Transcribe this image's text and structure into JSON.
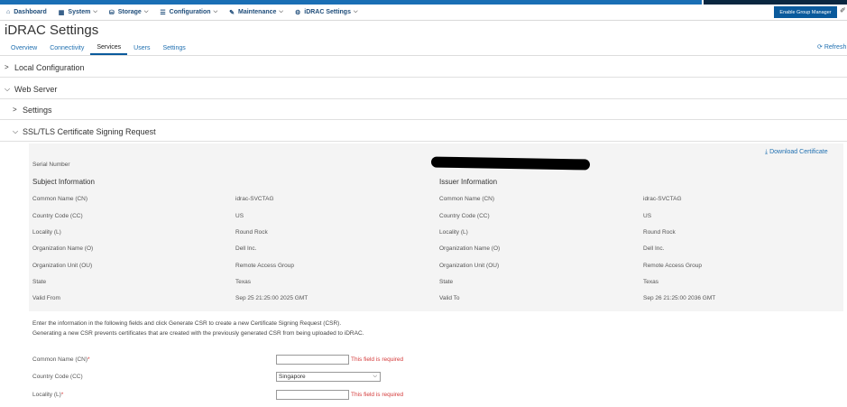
{
  "nav": {
    "items": [
      {
        "label": "Dashboard",
        "icon": "home-icon",
        "glyph": "⌂",
        "chevron": false
      },
      {
        "label": "System",
        "icon": "grid-icon",
        "glyph": "▦",
        "chevron": true
      },
      {
        "label": "Storage",
        "icon": "storage-icon",
        "glyph": "⛁",
        "chevron": true
      },
      {
        "label": "Configuration",
        "icon": "sliders-icon",
        "glyph": "☰",
        "chevron": true
      },
      {
        "label": "Maintenance",
        "icon": "wrench-icon",
        "glyph": "✎",
        "chevron": true
      },
      {
        "label": "iDRAC Settings",
        "icon": "gear-icon",
        "glyph": "⚙",
        "chevron": true
      }
    ],
    "group_manager_button": "Enable Group Manager"
  },
  "page": {
    "title": "iDRAC Settings",
    "tabs": [
      "Overview",
      "Connectivity",
      "Services",
      "Users",
      "Settings"
    ],
    "active_tab": "Services",
    "refresh": "Refresh"
  },
  "sections": {
    "local_configuration": "Local Configuration",
    "web_server": "Web Server",
    "settings": "Settings",
    "ssl_csr": "SSL/TLS Certificate Signing Request"
  },
  "certificate": {
    "download": "Download Certificate",
    "serial_label": "Serial Number",
    "subject_header": "Subject Information",
    "issuer_header": "Issuer Information",
    "subject": [
      {
        "label": "Common Name (CN)",
        "value": "idrac-SVCTAG"
      },
      {
        "label": "Country Code (CC)",
        "value": "US"
      },
      {
        "label": "Locality (L)",
        "value": "Round Rock"
      },
      {
        "label": "Organization Name (O)",
        "value": "Dell Inc."
      },
      {
        "label": "Organization Unit (OU)",
        "value": "Remote Access Group"
      },
      {
        "label": "State",
        "value": "Texas"
      },
      {
        "label": "Valid From",
        "value": "Sep 25 21:25:00 2025 GMT"
      }
    ],
    "issuer": [
      {
        "label": "Common Name (CN)",
        "value": "idrac-SVCTAG"
      },
      {
        "label": "Country Code (CC)",
        "value": "US"
      },
      {
        "label": "Locality (L)",
        "value": "Round Rock"
      },
      {
        "label": "Organization Name (O)",
        "value": "Dell Inc."
      },
      {
        "label": "Organization Unit (OU)",
        "value": "Remote Access Group"
      },
      {
        "label": "State",
        "value": "Texas"
      },
      {
        "label": "Valid To",
        "value": "Sep 26 21:25:00 2036 GMT"
      }
    ]
  },
  "csr": {
    "info_line1": "Enter the information in the following fields and click Generate CSR to create a new Certificate Signing Request (CSR).",
    "info_line2": "Generating a new CSR prevents certificates that are created with the previously generated CSR from being uploaded to iDRAC.",
    "fields": [
      {
        "label": "Common Name (CN)",
        "required": true,
        "type": "text",
        "value": "",
        "error": "This field is required"
      },
      {
        "label": "Country Code (CC)",
        "required": false,
        "type": "select",
        "value": "Singapore",
        "error": ""
      },
      {
        "label": "Locality (L)",
        "required": true,
        "type": "text",
        "value": "",
        "error": "This field is required"
      }
    ]
  },
  "colors": {
    "accent": "#1f6fb0",
    "error": "#d43a3a",
    "primary_button": "#0a5a9c"
  }
}
